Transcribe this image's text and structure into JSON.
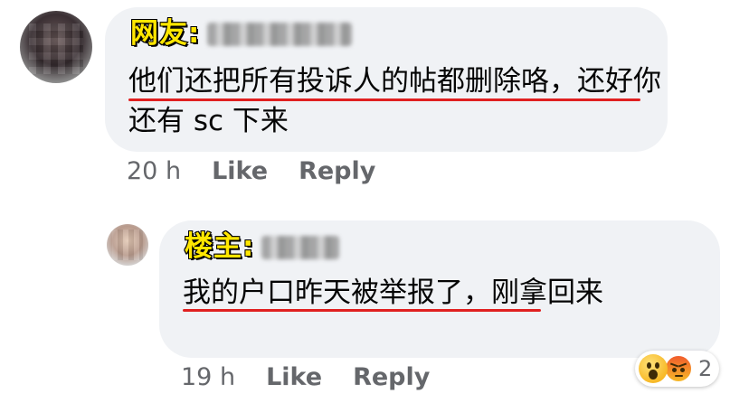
{
  "comment": {
    "tag": "网友:",
    "text": "他们还把所有投诉人的帖都删除咯，还好你还有 sc 下来",
    "time": "20 h",
    "like_label": "Like",
    "reply_label": "Reply"
  },
  "reply": {
    "tag": "楼主:",
    "text": "我的户口昨天被举报了，刚拿回来",
    "time": "19 h",
    "like_label": "Like",
    "reply_label": "Reply",
    "reactions": {
      "icons": [
        "wow-icon",
        "angry-icon"
      ],
      "count": "2"
    }
  },
  "colors": {
    "bubble": "#f0f2f5",
    "tag_fill": "#ffe600",
    "underline": "#e02020",
    "meta_text": "#65676b"
  }
}
